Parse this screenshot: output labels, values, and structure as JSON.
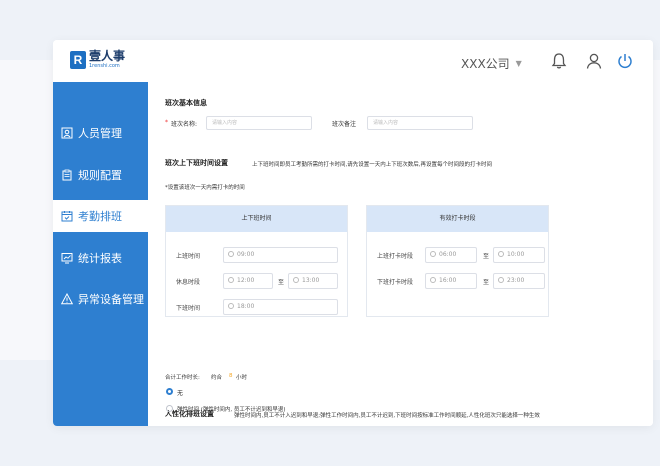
{
  "app": {
    "logo_mark": "R",
    "logo_name": "壹人事",
    "logo_domain": "1renshi.com",
    "company": "XXX公司"
  },
  "header_icons": [
    "bell-icon",
    "user-icon",
    "power-icon"
  ],
  "sidebar": {
    "items": [
      {
        "label": "人员管理",
        "icon": "person-card-icon",
        "active": false
      },
      {
        "label": "规则配置",
        "icon": "clipboard-icon",
        "active": false
      },
      {
        "label": "考勤排班",
        "icon": "calendar-icon",
        "active": true
      },
      {
        "label": "统计报表",
        "icon": "chart-icon",
        "active": false
      },
      {
        "label": "异常设备管理",
        "icon": "warning-icon",
        "active": false
      }
    ]
  },
  "basic": {
    "title": "班次基本信息",
    "name_required": "*",
    "name_label": "班次名称:",
    "name_placeholder": "请输入内容",
    "note_label": "班次备注",
    "note_placeholder": "请输入内容"
  },
  "time_settings": {
    "title": "班次上下班时间设置",
    "desc": "上下班时间即员工考勤所需的打卡时间,请先设置一天内上下班次数后,再设置每个时间段的打卡时间",
    "hint": "*设置该班次一天内需打卡的时间",
    "left_panel": {
      "header": "上下班时间",
      "on_label": "上班时间",
      "on_value": "09:00",
      "rest_label": "休息时段",
      "rest_start": "12:00",
      "rest_to": "至",
      "rest_end": "13:00",
      "off_label": "下班时间",
      "off_value": "18:00"
    },
    "right_panel": {
      "header": "有效打卡时段",
      "on_label": "上班打卡时段",
      "on_start": "06:00",
      "on_to": "至",
      "on_end": "10:00",
      "off_label": "下班打卡时段",
      "off_start": "16:00",
      "off_to": "至",
      "off_end": "23:00"
    },
    "total_label": "合计工作时长:",
    "total_prefix": "约合",
    "total_hours": "8",
    "total_unit": "小时"
  },
  "humanized": {
    "title": "人性化排班设置",
    "desc": "弹性时间内,员工不计入迟到和早退;弹性工作时间内,员工不计迟到,下班时间按标准工作时间顺延,人性化班次只能选择一种生效",
    "options": [
      {
        "label": "无",
        "selected": true
      },
      {
        "label": "弹性时间 (弹性时间内, 员工不计迟到和早退)",
        "selected": false
      }
    ]
  },
  "colors": {
    "sidebar": "#2e7fd0",
    "panel_header": "#d8e6f8",
    "accent_hours": "#f5a623"
  }
}
